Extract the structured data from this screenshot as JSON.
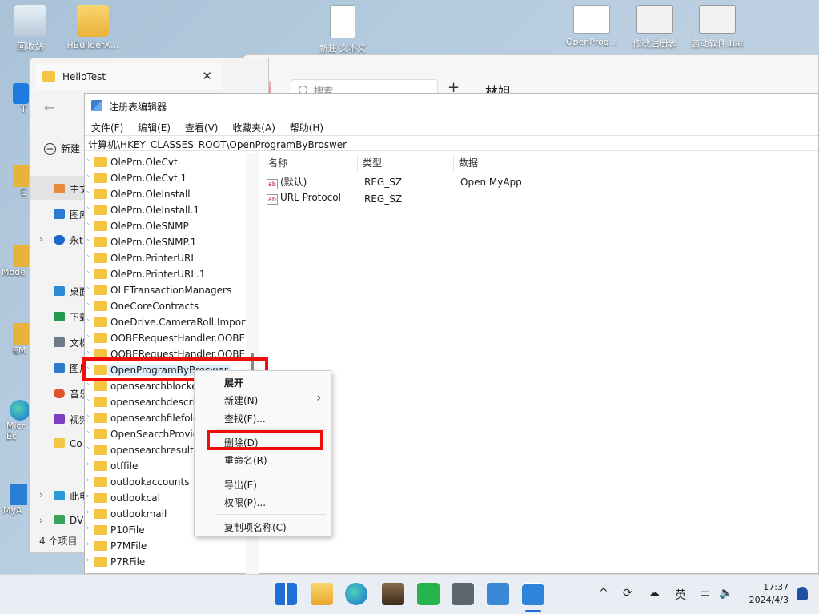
{
  "desktop": {
    "icons": [
      {
        "label": "回收站",
        "type": "bin"
      },
      {
        "label": "HBuilderX...",
        "type": "folder"
      },
      {
        "label": "新建 文本文",
        "type": "doc"
      },
      {
        "label": "OpenProg...",
        "type": "app"
      },
      {
        "label": "修改注册表",
        "type": "gear"
      },
      {
        "label": "启动软件.bat",
        "type": "gear"
      }
    ],
    "left_fragments": [
      "T",
      "E",
      "Mode",
      "EM",
      "Micr Ec",
      "MyA"
    ]
  },
  "explorer": {
    "tab_title": "HelloTest",
    "new_label": "新建",
    "nav": [
      {
        "label": "主文",
        "icon": "home-icon"
      },
      {
        "label": "图库",
        "icon": "gallery-icon"
      },
      {
        "label": "永t",
        "icon": "cloud-icon"
      },
      {
        "label": "桌面",
        "icon": "desktop-icon"
      },
      {
        "label": "下载",
        "icon": "download-icon"
      },
      {
        "label": "文档",
        "icon": "document-icon"
      },
      {
        "label": "图片",
        "icon": "picture-icon"
      },
      {
        "label": "音乐",
        "icon": "music-icon"
      },
      {
        "label": "视频",
        "icon": "video-icon"
      },
      {
        "label": "Co",
        "icon": "folder-icon"
      },
      {
        "label": "此电",
        "icon": "pc-icon"
      },
      {
        "label": "DV",
        "icon": "dvd-icon"
      }
    ],
    "status": "4 个项目"
  },
  "bgwin": {
    "search_placeholder": "搜索",
    "contact_name": "林姐"
  },
  "regedit": {
    "title": "注册表编辑器",
    "menu": [
      "文件(F)",
      "编辑(E)",
      "查看(V)",
      "收藏夹(A)",
      "帮助(H)"
    ],
    "address": "计算机\\HKEY_CLASSES_ROOT\\OpenProgramByBroswer",
    "tree": [
      "OlePrn.OleCvt",
      "OlePrn.OleCvt.1",
      "OlePrn.OleInstall",
      "OlePrn.OleInstall.1",
      "OlePrn.OleSNMP",
      "OlePrn.OleSNMP.1",
      "OlePrn.PrinterURL",
      "OlePrn.PrinterURL.1",
      "OLETransactionManagers",
      "OneCoreContracts",
      "OneDrive.CameraRoll.Import",
      "OOBERequestHandler.OOBE",
      "OOBERequestHandler.OOBE",
      "OpenProgramByBroswer",
      "opensearchblocke",
      "opensearchdescrip",
      "opensearchfilefolc",
      "OpenSearchProvic",
      "opensearchresult",
      "otffile",
      "outlookaccounts",
      "outlookcal",
      "outlookmail",
      "P10File",
      "P7MFile",
      "P7RFile"
    ],
    "selected_index": 13,
    "columns": [
      "名称",
      "类型",
      "数据"
    ],
    "values": [
      {
        "name": "(默认)",
        "type": "REG_SZ",
        "data": "Open MyApp"
      },
      {
        "name": "URL Protocol",
        "type": "REG_SZ",
        "data": ""
      }
    ]
  },
  "context_menu": {
    "items": [
      "展开",
      "新建(N)",
      "查找(F)...",
      "删除(D)",
      "重命名(R)",
      "导出(E)",
      "权限(P)...",
      "复制项名称(C)"
    ]
  },
  "taskbar": {
    "tray_lang": "英",
    "time": "17:37",
    "date": "2024/4/3"
  },
  "colors": {
    "highlight_red": "#f20d0d",
    "folder_yellow": "#f4c542",
    "selection_blue": "#dceefc"
  }
}
